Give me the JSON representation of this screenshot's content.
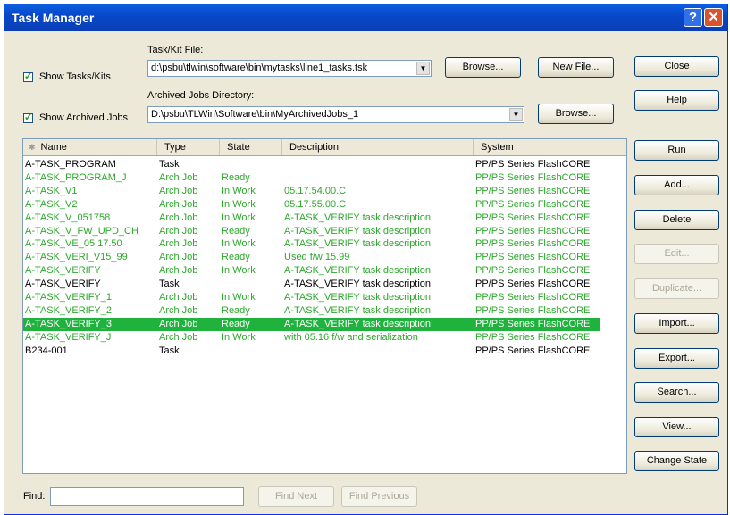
{
  "window": {
    "title": "Task Manager",
    "help_glyph": "?",
    "close_glyph": "✕"
  },
  "form": {
    "show_tasks_label": "Show Tasks/Kits",
    "show_archived_label": "Show Archived Jobs",
    "taskkit_file_label": "Task/Kit File:",
    "taskkit_file_value": "d:\\psbu\\tlwin\\software\\bin\\mytasks\\line1_tasks.tsk",
    "archived_dir_label": "Archived Jobs Directory:",
    "archived_dir_value": "D:\\psbu\\TLWin\\Software\\bin\\MyArchivedJobs_1",
    "browse1": "Browse...",
    "new_file": "New File...",
    "browse2": "Browse...",
    "find_label": "Find:",
    "find_value": "",
    "find_next": "Find Next",
    "find_previous": "Find Previous"
  },
  "side_buttons": {
    "close": "Close",
    "help": "Help",
    "run": "Run",
    "add": "Add...",
    "delete": "Delete",
    "edit": "Edit...",
    "duplicate": "Duplicate...",
    "import": "Import...",
    "export": "Export...",
    "search": "Search...",
    "view": "View...",
    "change_state": "Change State"
  },
  "colors": {
    "green_text": "#2ca82c",
    "selected_row": "#1fb33e",
    "title_bar": "#0848c9"
  },
  "columns": [
    "Name",
    "Type",
    "State",
    "Description",
    "System"
  ],
  "rows": [
    {
      "name": "A-TASK_PROGRAM",
      "type": "Task",
      "state": "",
      "description": "",
      "system": "PP/PS Series FlashCORE",
      "color": "black"
    },
    {
      "name": "A-TASK_PROGRAM_J",
      "type": "Arch Job",
      "state": "Ready",
      "description": "",
      "system": "PP/PS Series FlashCORE",
      "color": "green"
    },
    {
      "name": "A-TASK_V1",
      "type": "Arch Job",
      "state": "In Work",
      "description": "05.17.54.00.C",
      "system": "PP/PS Series FlashCORE",
      "color": "green"
    },
    {
      "name": "A-TASK_V2",
      "type": "Arch Job",
      "state": "In Work",
      "description": "05.17.55.00.C",
      "system": "PP/PS Series FlashCORE",
      "color": "green"
    },
    {
      "name": "A-TASK_V_051758",
      "type": "Arch Job",
      "state": "In Work",
      "description": "A-TASK_VERIFY task description",
      "system": "PP/PS Series FlashCORE",
      "color": "green"
    },
    {
      "name": "A-TASK_V_FW_UPD_CH",
      "type": "Arch Job",
      "state": "Ready",
      "description": "A-TASK_VERIFY task description",
      "system": "PP/PS Series FlashCORE",
      "color": "green"
    },
    {
      "name": "A-TASK_VE_05.17.50",
      "type": "Arch Job",
      "state": "In Work",
      "description": "A-TASK_VERIFY task description",
      "system": "PP/PS Series FlashCORE",
      "color": "green"
    },
    {
      "name": "A-TASK_VERI_V15_99",
      "type": "Arch Job",
      "state": "Ready",
      "description": "Used f/w 15.99",
      "system": "PP/PS Series FlashCORE",
      "color": "green"
    },
    {
      "name": "A-TASK_VERIFY",
      "type": "Arch Job",
      "state": "In Work",
      "description": "A-TASK_VERIFY task description",
      "system": "PP/PS Series FlashCORE",
      "color": "green"
    },
    {
      "name": "A-TASK_VERIFY",
      "type": "Task",
      "state": "",
      "description": "A-TASK_VERIFY task description",
      "system": "PP/PS Series FlashCORE",
      "color": "black"
    },
    {
      "name": "A-TASK_VERIFY_1",
      "type": "Arch Job",
      "state": "In Work",
      "description": "A-TASK_VERIFY task description",
      "system": "PP/PS Series FlashCORE",
      "color": "green"
    },
    {
      "name": "A-TASK_VERIFY_2",
      "type": "Arch Job",
      "state": "Ready",
      "description": "A-TASK_VERIFY task description",
      "system": "PP/PS Series FlashCORE",
      "color": "green"
    },
    {
      "name": "A-TASK_VERIFY_3",
      "type": "Arch Job",
      "state": "Ready",
      "description": "A-TASK_VERIFY task description",
      "system": "PP/PS Series FlashCORE",
      "color": "selected"
    },
    {
      "name": "A-TASK_VERIFY_J",
      "type": "Arch Job",
      "state": "In Work",
      "description": "with 05.16 f/w and serialization",
      "system": "PP/PS Series FlashCORE",
      "color": "green"
    },
    {
      "name": "B234-001",
      "type": "Task",
      "state": "",
      "description": "",
      "system": "PP/PS Series FlashCORE",
      "color": "black"
    }
  ]
}
